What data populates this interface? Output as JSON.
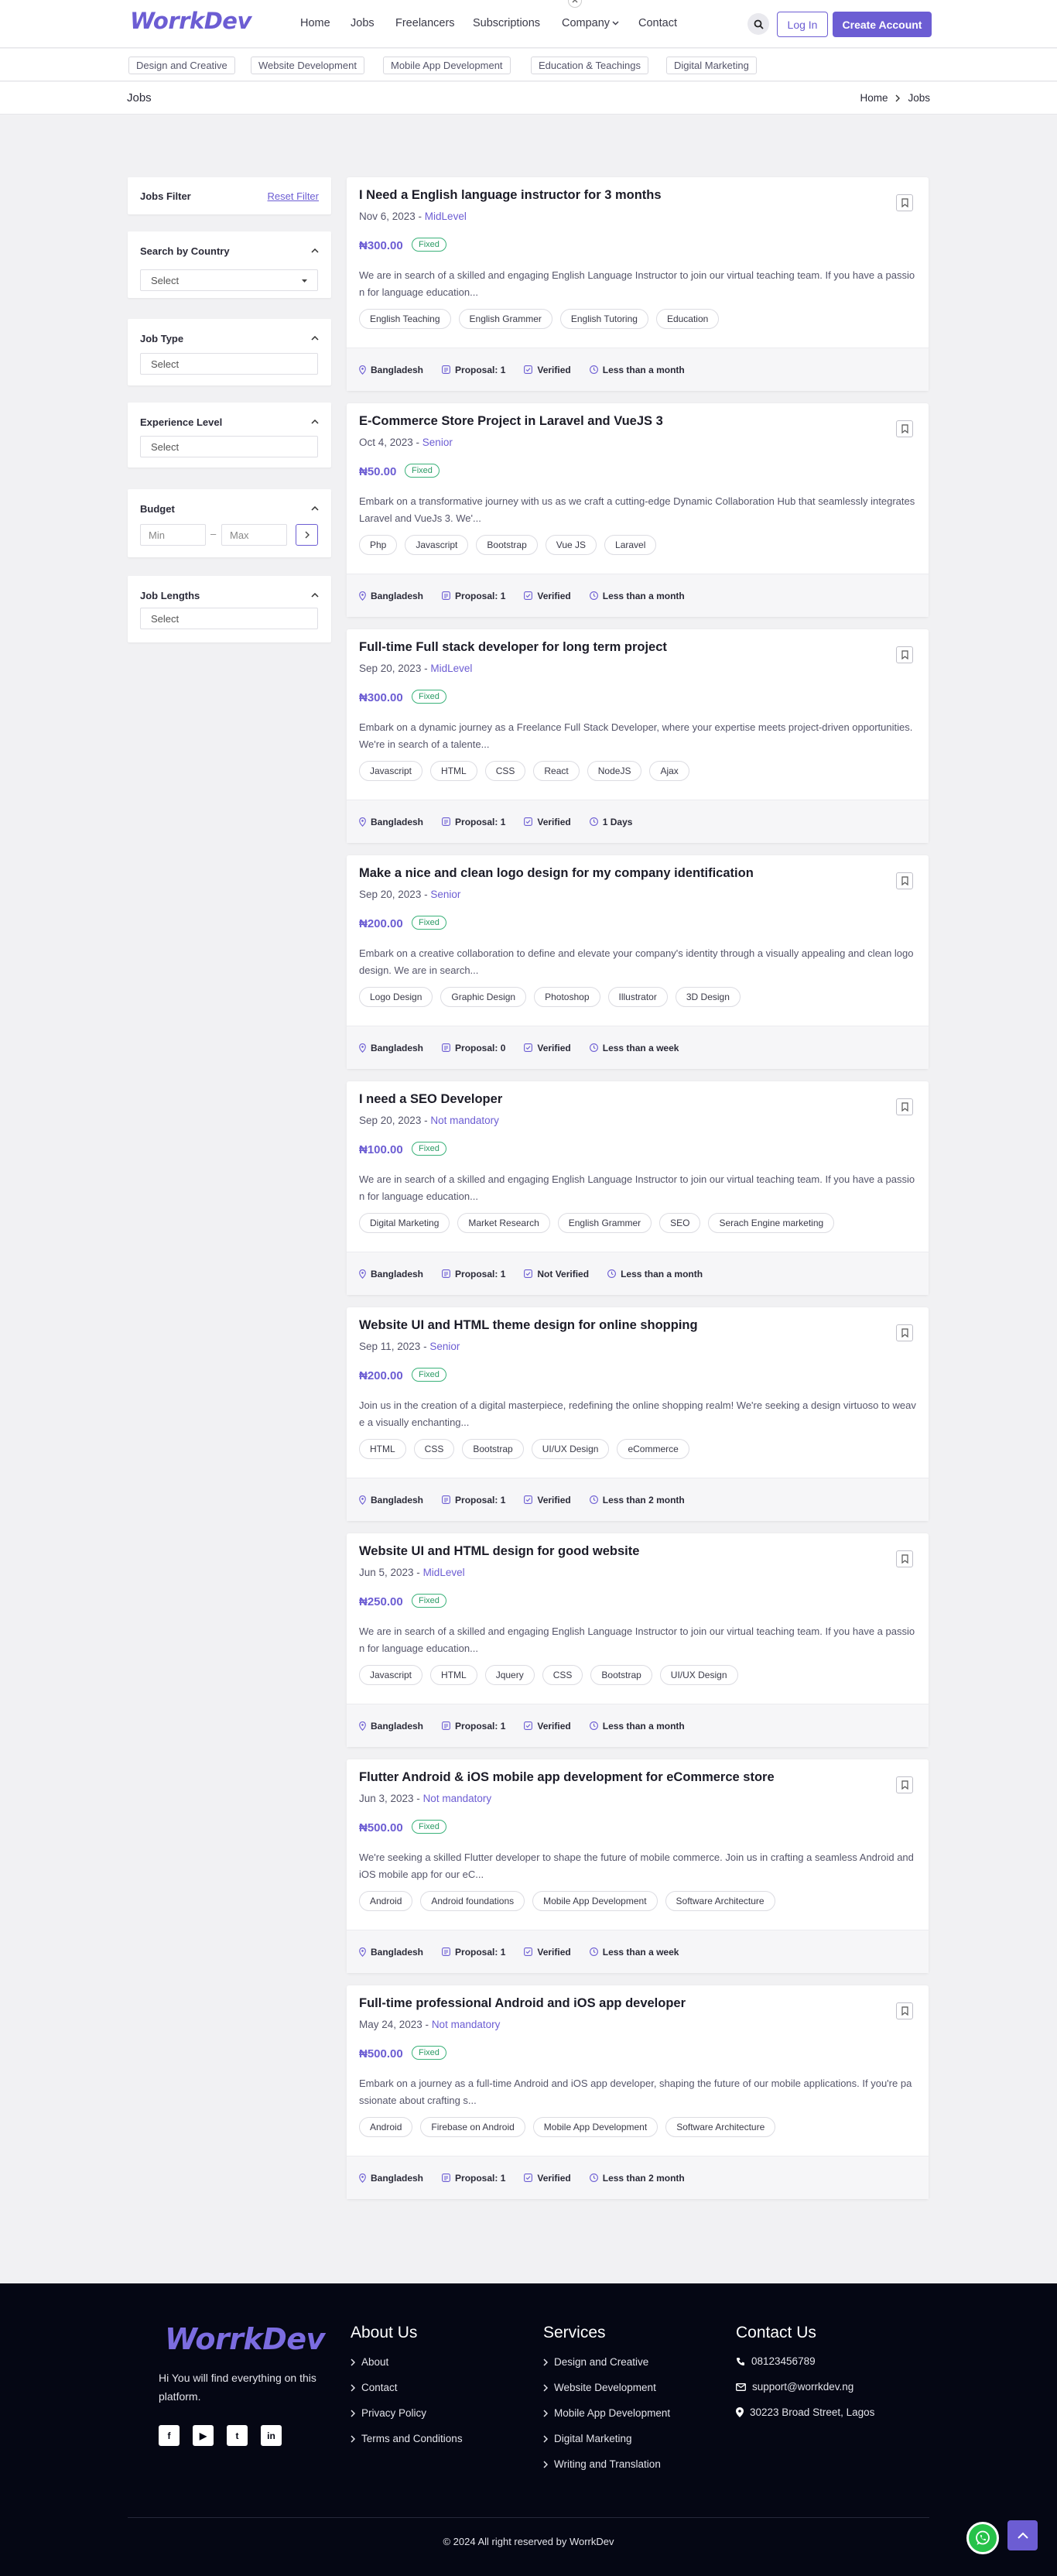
{
  "brand": {
    "logo": "WorrkDev",
    "accent": "#6c5dd3",
    "footer_bg": "#050714"
  },
  "nav": {
    "items": [
      "Home",
      "Jobs",
      "Freelancers",
      "Subscriptions",
      "Company",
      "Contact"
    ],
    "login": "Log In",
    "create": "Create Account"
  },
  "categories": [
    "Design and Creative",
    "Website Development",
    "Mobile App Development",
    "Education & Teachings",
    "Digital Marketing"
  ],
  "breadcrumb": {
    "title": "Jobs",
    "home": "Home",
    "current": "Jobs"
  },
  "filters": {
    "title": "Jobs Filter",
    "reset": "Reset Filter",
    "country": {
      "label": "Search by Country",
      "value": "Select"
    },
    "job_type": {
      "label": "Job Type",
      "value": "Select"
    },
    "experience": {
      "label": "Experience Level",
      "value": "Select"
    },
    "budget": {
      "label": "Budget",
      "min": "Min",
      "max": "Max",
      "sep": "–"
    },
    "lengths": {
      "label": "Job Lengths",
      "value": "Select"
    }
  },
  "jobs": [
    {
      "title": "I Need a English language instructor for 3 months",
      "date": "Nov 6, 2023 - ",
      "level": "MidLevel",
      "price": "₦300.00",
      "type": "Fixed",
      "desc": "We are in search of a skilled and engaging English Language Instructor to join our virtual teaching team. If you have a passion for language education...",
      "tags": [
        "English Teaching",
        "English Grammer",
        "English Tutoring",
        "Education"
      ],
      "location": "Bangladesh",
      "proposals": "Proposal: 1",
      "verified": "Verified",
      "duration": "Less than a month"
    },
    {
      "title": "E-Commerce Store Project in Laravel and VueJS 3",
      "date": "Oct 4, 2023 - ",
      "level": "Senior",
      "price": "₦50.00",
      "type": "Fixed",
      "desc": "Embark on a transformative journey with us as we craft a cutting-edge Dynamic Collaboration Hub that seamlessly integrates Laravel and VueJs 3. We'...",
      "tags": [
        "Php",
        "Javascript",
        "Bootstrap",
        "Vue JS",
        "Laravel"
      ],
      "location": "Bangladesh",
      "proposals": "Proposal: 1",
      "verified": "Verified",
      "duration": "Less than a month"
    },
    {
      "title": "Full-time Full stack developer for long term project",
      "date": "Sep 20, 2023 - ",
      "level": "MidLevel",
      "price": "₦300.00",
      "type": "Fixed",
      "desc": "Embark on a dynamic journey as a Freelance Full Stack Developer, where your expertise meets project-driven opportunities. We're in search of a talente...",
      "tags": [
        "Javascript",
        "HTML",
        "CSS",
        "React",
        "NodeJS",
        "Ajax"
      ],
      "location": "Bangladesh",
      "proposals": "Proposal: 1",
      "verified": "Verified",
      "duration": "1 Days"
    },
    {
      "title": "Make a nice and clean logo design for my company identification",
      "date": "Sep 20, 2023 - ",
      "level": "Senior",
      "price": "₦200.00",
      "type": "Fixed",
      "desc": "Embark on a creative collaboration to define and elevate your company's identity through a visually appealing and clean logo design. We are in search...",
      "tags": [
        "Logo Design",
        "Graphic Design",
        "Photoshop",
        "Illustrator",
        "3D Design"
      ],
      "location": "Bangladesh",
      "proposals": "Proposal: 0",
      "verified": "Verified",
      "duration": "Less than a week"
    },
    {
      "title": "I need a SEO Developer",
      "date": "Sep 20, 2023 - ",
      "level": "Not mandatory",
      "price": "₦100.00",
      "type": "Fixed",
      "desc": "We are in search of a skilled and engaging English Language Instructor to join our virtual teaching team. If you have a passion for language education...",
      "tags": [
        "Digital Marketing",
        "Market Research",
        "English Grammer",
        "SEO",
        "Serach Engine marketing"
      ],
      "location": "Bangladesh",
      "proposals": "Proposal: 1",
      "verified": "Not Verified",
      "duration": "Less than a month"
    },
    {
      "title": "Website UI and HTML theme design for online shopping",
      "date": "Sep 11, 2023 - ",
      "level": "Senior",
      "price": "₦200.00",
      "type": "Fixed",
      "desc": "Join us in the creation of a digital masterpiece, redefining the online shopping realm! We're seeking a design virtuoso to weave a visually enchanting...",
      "tags": [
        "HTML",
        "CSS",
        "Bootstrap",
        "UI/UX Design",
        "eCommerce"
      ],
      "location": "Bangladesh",
      "proposals": "Proposal: 1",
      "verified": "Verified",
      "duration": "Less than 2 month"
    },
    {
      "title": "Website UI and HTML design for good website",
      "date": "Jun 5, 2023 - ",
      "level": "MidLevel",
      "price": "₦250.00",
      "type": "Fixed",
      "desc": "We are in search of a skilled and engaging English Language Instructor to join our virtual teaching team. If you have a passion for language education...",
      "tags": [
        "Javascript",
        "HTML",
        "Jquery",
        "CSS",
        "Bootstrap",
        "UI/UX Design"
      ],
      "location": "Bangladesh",
      "proposals": "Proposal: 1",
      "verified": "Verified",
      "duration": "Less than a month"
    },
    {
      "title": "Flutter Android & iOS mobile app development for eCommerce store",
      "date": "Jun 3, 2023 - ",
      "level": "Not mandatory",
      "price": "₦500.00",
      "type": "Fixed",
      "desc": "We're seeking a skilled Flutter developer to shape the future of mobile commerce. Join us in crafting a seamless Android and iOS mobile app for our eC...",
      "tags": [
        "Android",
        "Android foundations",
        "Mobile App Development",
        "Software Architecture"
      ],
      "location": "Bangladesh",
      "proposals": "Proposal: 1",
      "verified": "Verified",
      "duration": "Less than a week"
    },
    {
      "title": "Full-time professional Android and iOS app developer",
      "date": "May 24, 2023 - ",
      "level": "Not mandatory",
      "price": "₦500.00",
      "type": "Fixed",
      "desc": "Embark on a journey as a full-time Android and iOS app developer, shaping the future of our mobile applications. If you're passionate about crafting s...",
      "tags": [
        "Android",
        "Firebase on Android",
        "Mobile App Development",
        "Software Architecture"
      ],
      "location": "Bangladesh",
      "proposals": "Proposal: 1",
      "verified": "Verified",
      "duration": "Less than 2 month"
    }
  ],
  "footer": {
    "tagline": "Hi You will find everything on this platform.",
    "social": [
      "f",
      "▶",
      "t",
      "in"
    ],
    "about": {
      "title": "About Us",
      "links": [
        "About",
        "Contact",
        "Privacy Policy",
        "Terms and Conditions"
      ]
    },
    "services": {
      "title": "Services",
      "links": [
        "Design and Creative",
        "Website Development",
        "Mobile App Development",
        "Digital Marketing",
        "Writing and Translation"
      ]
    },
    "contact": {
      "title": "Contact Us",
      "phone": "08123456789",
      "email": "support@worrkdev.ng",
      "address": "30223 Broad Street, Lagos"
    },
    "copyright": "© 2024 All right reserved by WorrkDev"
  }
}
